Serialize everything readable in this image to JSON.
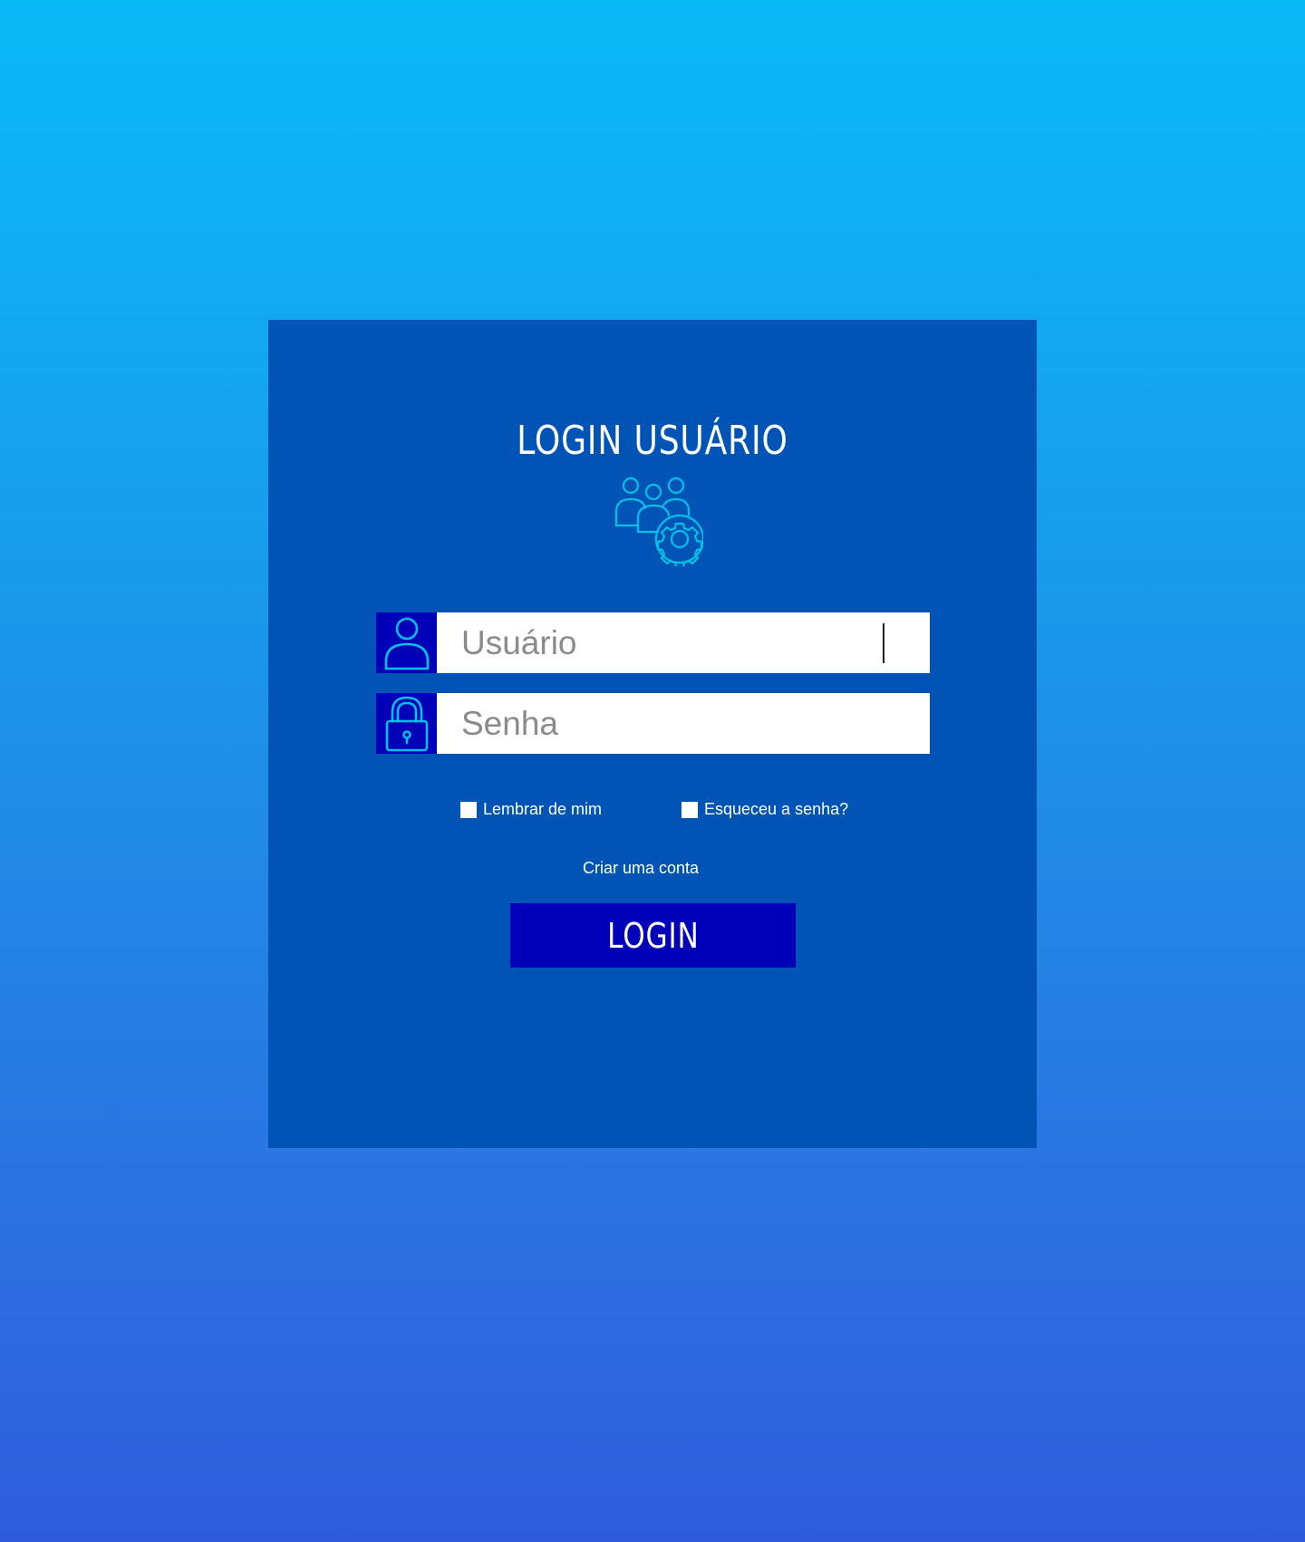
{
  "login_card": {
    "title": "LOGIN USUÁRIO",
    "hero_icon": "users-gear-icon",
    "username": {
      "icon": "user-icon",
      "placeholder": "Usuário",
      "value": ""
    },
    "password": {
      "icon": "lock-icon",
      "placeholder": "Senha",
      "value": ""
    },
    "remember_me_label": "Lembrar de mim",
    "forgot_password_label": "Esqueceu a senha?",
    "create_account_label": "Criar uma conta",
    "login_button_label": "LOGIN"
  },
  "colors": {
    "card_background": "#0054b6",
    "accent_dark_blue": "#0000b8",
    "icon_cyan": "#00c2e6",
    "background_gradient_top": "#0abaf7",
    "background_gradient_bottom": "#305cdc"
  }
}
